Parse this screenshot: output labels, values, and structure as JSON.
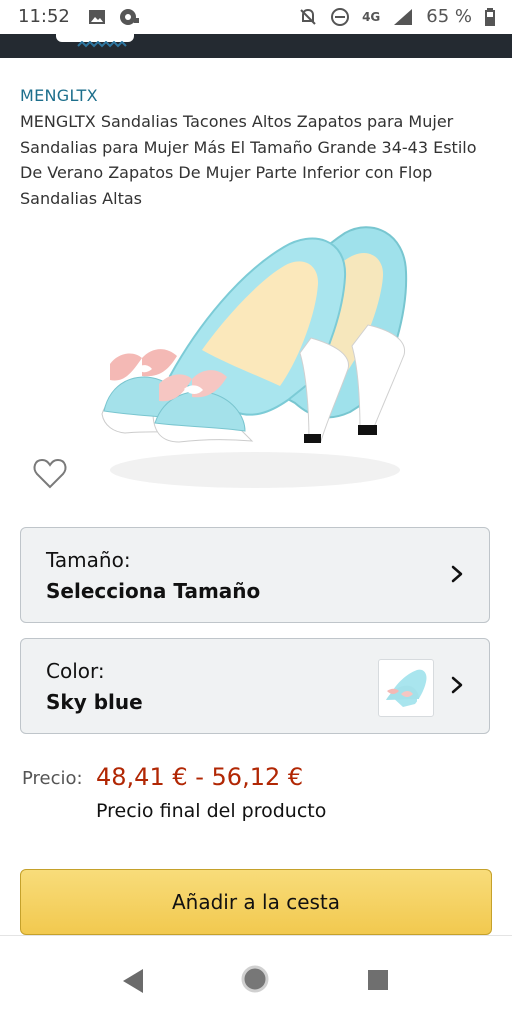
{
  "status_bar": {
    "time": "11:52",
    "network": "4G",
    "battery_text": "65 %",
    "icons": [
      "image-icon",
      "camera-sync-icon",
      "notifications-off-icon",
      "do-not-disturb-icon",
      "signal-icon",
      "battery-icon"
    ]
  },
  "product": {
    "brand": "MENGLTX",
    "title": "MENGLTX Sandalias Tacones Altos Zapatos para Mujer Sandalias para Mujer Más El Tamaño Grande 34-43 Estilo De Verano Zapatos De Mujer Parte Inferior con Flop Sandalias Altas"
  },
  "options": {
    "size": {
      "label": "Tamaño:",
      "value": "Selecciona Tamaño"
    },
    "color": {
      "label": "Color:",
      "value": "Sky blue"
    }
  },
  "pricing": {
    "label": "Precio:",
    "range": "48,41 € - 56,12 €",
    "note": "Precio final del producto"
  },
  "actions": {
    "add_to_cart": "Añadir a la cesta"
  },
  "colors": {
    "price": "#b12704",
    "brand_link": "#1d6f8c",
    "button": "#f2c94f",
    "shoe": "#9fe1eb",
    "bow": "#f4b9b5"
  }
}
